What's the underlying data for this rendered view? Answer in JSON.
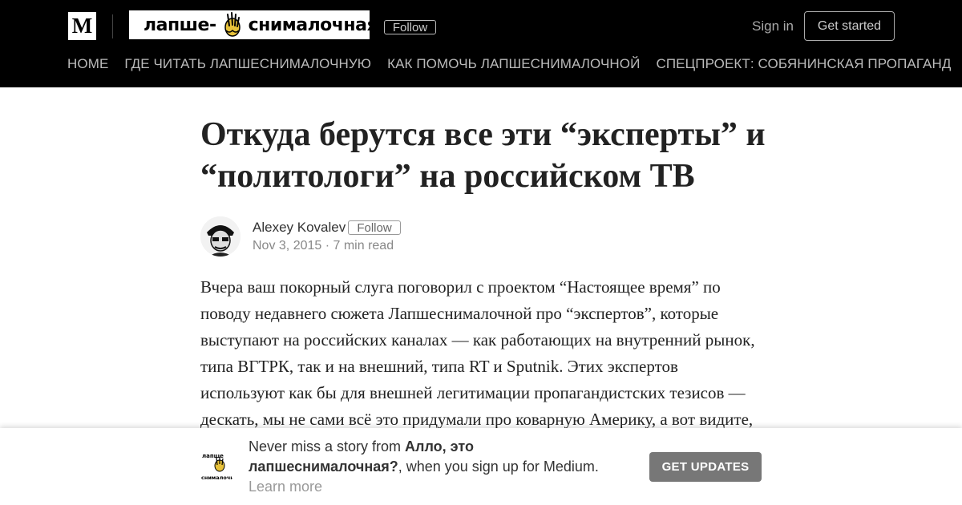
{
  "header": {
    "medium_logo": "M",
    "publication_logo": {
      "left": "лапше-",
      "right": "снималочная",
      "icon": "noodle-hand-icon"
    },
    "follow_label": "Follow",
    "sign_in_label": "Sign in",
    "get_started_label": "Get started",
    "nav": [
      "HOME",
      "ГДЕ ЧИТАТЬ ЛАПШЕСНИМАЛОЧНУЮ",
      "КАК ПОМОЧЬ ЛАПШЕСНИМАЛОЧНОЙ",
      "СПЕЦПРОЕКТ: СОБЯНИНСКАЯ ПРОПАГАНД"
    ]
  },
  "article": {
    "title": "Откуда берутся все эти “эксперты” и “политологи” на российском ТВ",
    "author": {
      "name": "Alexey Kovalev",
      "follow_label": "Follow",
      "avatar_icon": "author-portrait-icon"
    },
    "meta": "Nov 3, 2015 · 7 min read",
    "body": "Вчера ваш покорный слуга поговорил с проектом “Настоящее время” по поводу недавнего сюжета Лапшеснималочной про “экспертов”, которые выступают на российских каналах — как работающих на внутренний рынок, типа ВГТРК, так и на внешний, типа RT и Sputnik. Этих экспертов используют как бы для внешней легитимации пропагандистских тезисов — дескать, мы не сами всё это придумали про коварную Америку, а вот видите,"
  },
  "banner": {
    "logo_icon": "publication-logo-icon",
    "logo_text_top": "лапше",
    "logo_text_bottom": "снималочная",
    "text_before": "Never miss a story from ",
    "publication_name": "Алло, это лапшеснималочная?",
    "text_after": ", when you sign up for Medium.",
    "learn_more_label": "Learn more",
    "get_updates_label": "GET UPDATES"
  },
  "colors": {
    "header_bg": "#000000",
    "button_gray": "#777777",
    "text_dark": "#222222"
  }
}
